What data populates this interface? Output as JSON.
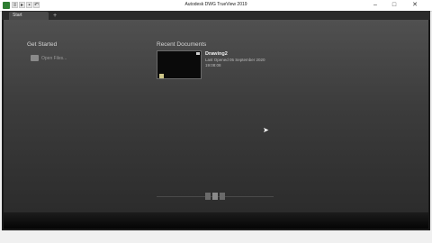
{
  "window": {
    "title": "Autodesk DWG TrueView 2019"
  },
  "quick_access": [
    "app-menu",
    "open",
    "print",
    "undo"
  ],
  "tabs": [
    {
      "label": "Start"
    }
  ],
  "tab_add_label": "+",
  "get_started": {
    "title": "Get Started",
    "open_files_label": "Open Files..."
  },
  "recent": {
    "title": "Recent Documents",
    "items": [
      {
        "name": "Drawing2",
        "opened": "Last Opened 05 September 2020",
        "time": "19:08:08"
      }
    ]
  },
  "colors": {
    "accent_logo": "#2e7d32",
    "content_top": "#505050",
    "content_bottom": "#2c2c2c"
  }
}
